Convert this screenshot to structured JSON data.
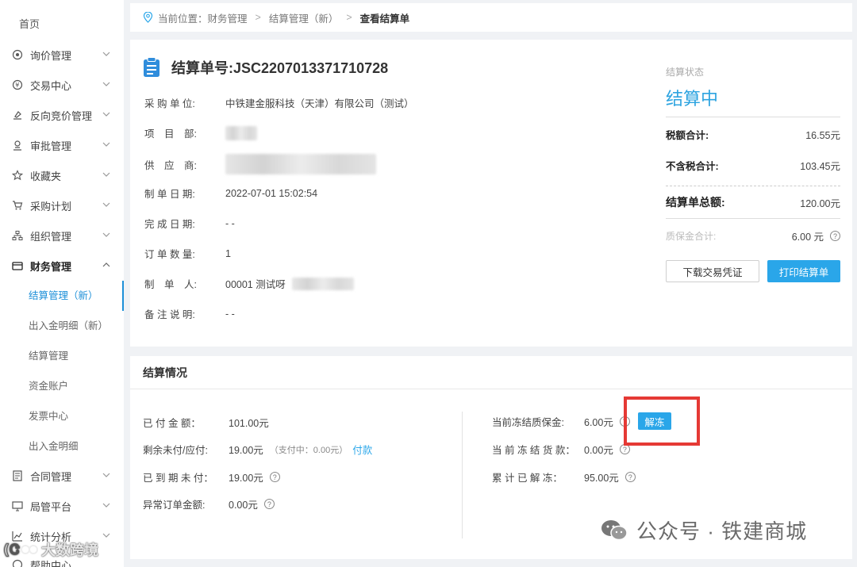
{
  "sidebar": {
    "home": "首页",
    "items": [
      {
        "label": "询价管理",
        "icon": "inquiry-icon"
      },
      {
        "label": "交易中心",
        "icon": "trade-icon"
      },
      {
        "label": "反向竞价管理",
        "icon": "auction-icon"
      },
      {
        "label": "审批管理",
        "icon": "approval-icon"
      },
      {
        "label": "收藏夹",
        "icon": "star-icon"
      },
      {
        "label": "采购计划",
        "icon": "cart-icon"
      },
      {
        "label": "组织管理",
        "icon": "org-icon"
      },
      {
        "label": "财务管理",
        "icon": "finance-icon"
      }
    ],
    "finance_sub": [
      "结算管理（新）",
      "出入金明细（新）",
      "结算管理",
      "资金账户",
      "发票中心",
      "出入金明细"
    ],
    "items_after": [
      {
        "label": "合同管理",
        "icon": "contract-icon"
      },
      {
        "label": "局管平台",
        "icon": "monitor-icon"
      },
      {
        "label": "统计分析",
        "icon": "stats-icon"
      },
      {
        "label": "帮助中心",
        "icon": "help-icon"
      }
    ]
  },
  "breadcrumb": {
    "prefix": "当前位置：财务管理",
    "mid": "结算管理（新）",
    "current": "查看结算单",
    "sep": ">"
  },
  "order": {
    "title": "结算单号:JSC2207013371710728",
    "fields": [
      {
        "label": "采 购 单 位:",
        "value": "中铁建金服科技（天津）有限公司（测试）"
      },
      {
        "label": "项　目　部:",
        "value": ""
      },
      {
        "label": "供　应　商:",
        "value": ""
      },
      {
        "label": "制 单 日 期:",
        "value": "2022-07-01 15:02:54"
      },
      {
        "label": "完 成 日 期:",
        "value": "- -"
      },
      {
        "label": "订 单 数 量:",
        "value": "1"
      },
      {
        "label": "制　单　人:",
        "value": "00001 测试呀"
      },
      {
        "label": "备 注 说 明:",
        "value": "- -"
      }
    ]
  },
  "summary": {
    "status_label": "结算状态",
    "status": "结算中",
    "tax_label": "税额合计:",
    "tax_value": "16.55元",
    "pretax_label": "不含税合计:",
    "pretax_value": "103.45元",
    "total_label": "结算单总额:",
    "total_value": "120.00元",
    "deposit_label": "质保金合计:",
    "deposit_value": "6.00 元",
    "btn_download": "下载交易凭证",
    "btn_print": "打印结算单"
  },
  "settlement": {
    "title": "结算情况",
    "left": [
      {
        "label": "已 付 金 额：",
        "value": "101.00元"
      },
      {
        "label": "剩余未付/应付:",
        "value": "19.00元",
        "note": "（支付中：0.00元）",
        "link": "付款"
      },
      {
        "label": "已 到 期 未 付：",
        "value": "19.00元"
      },
      {
        "label": "异常订单金额:",
        "value": "0.00元"
      }
    ],
    "right": [
      {
        "label": "当前冻结质保金:",
        "value": "6.00元"
      },
      {
        "label": "当 前 冻 结 货 款：",
        "value": "0.00元"
      },
      {
        "label": "累 计 已 解 冻：",
        "value": "95.00元"
      }
    ],
    "unfreeze_btn": "解冻"
  },
  "watermark": {
    "right": "公众号 · 铁建商城",
    "left": "大数跨境"
  },
  "colors": {
    "accent": "#2aa6e9",
    "highlight": "#e53935"
  }
}
